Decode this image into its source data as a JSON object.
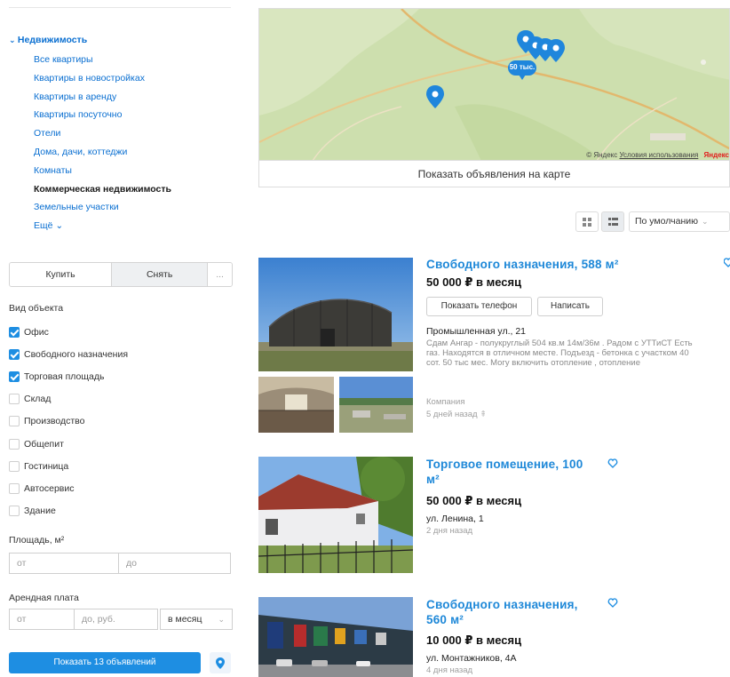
{
  "sidebar": {
    "category_root": "Недвижимость",
    "categories": [
      {
        "label": "Все квартиры",
        "active": false
      },
      {
        "label": "Квартиры в новостройках",
        "active": false
      },
      {
        "label": "Квартиры в аренду",
        "active": false
      },
      {
        "label": "Квартиры посуточно",
        "active": false
      },
      {
        "label": "Отели",
        "active": false
      },
      {
        "label": "Дома, дачи, коттеджи",
        "active": false
      },
      {
        "label": "Комнаты",
        "active": false
      },
      {
        "label": "Коммерческая недвижимость",
        "active": true
      },
      {
        "label": "Земельные участки",
        "active": false
      },
      {
        "label": "Ещё",
        "active": false
      }
    ],
    "deal_buy": "Купить",
    "deal_rent": "Снять",
    "deal_more": "...",
    "object_type_title": "Вид объекта",
    "object_types": [
      {
        "label": "Офис",
        "checked": true
      },
      {
        "label": "Свободного назначения",
        "checked": true
      },
      {
        "label": "Торговая площадь",
        "checked": true
      },
      {
        "label": "Склад",
        "checked": false
      },
      {
        "label": "Производство",
        "checked": false
      },
      {
        "label": "Общепит",
        "checked": false
      },
      {
        "label": "Гостиница",
        "checked": false
      },
      {
        "label": "Автосервис",
        "checked": false
      },
      {
        "label": "Здание",
        "checked": false
      }
    ],
    "area_title": "Площадь, м²",
    "area_from_placeholder": "от",
    "area_to_placeholder": "до",
    "rent_title": "Арендная плата",
    "rent_from_placeholder": "от",
    "rent_to_placeholder": "до, руб.",
    "rent_period": "в месяц",
    "show_button": "Показать 13 объявлений"
  },
  "map": {
    "cluster_label": "50 тыс.",
    "copyright": "© Яндекс",
    "terms": "Условия использования",
    "brand": "Яндекс",
    "show_on_map": "Показать объявления на карте"
  },
  "view": {
    "sort": "По умолчанию"
  },
  "listings": [
    {
      "title": "Свободного назначения, 588 м²",
      "price": "50 000 ₽ в месяц",
      "show_phone": "Показать телефон",
      "write": "Написать",
      "address": "Промышленная ул., 21",
      "description": "Сдам Ангар - полукруглый 504 кв.м 14м/36м . Радом с УТТиСТ Есть газ. Находятся в отличном месте. Подъезд - бетонка с участком 40 сот. 50 тыс мес. Могу включить отопление , отопление",
      "seller": "Компания",
      "time": "5 дней назад"
    },
    {
      "title_line1": "Торговое помещение, 100",
      "title_line2": "м²",
      "price": "50 000 ₽ в месяц",
      "address": "ул. Ленина, 1",
      "time": "2 дня назад"
    },
    {
      "title_line1": "Свободного назначения,",
      "title_line2": "560 м²",
      "price": "10 000 ₽ в месяц",
      "address": "ул. Монтажников, 4А",
      "time": "4 дня назад"
    }
  ],
  "colors": {
    "link": "#0a6fd1",
    "accent": "#1e8ee2",
    "title": "#1e88d8"
  }
}
